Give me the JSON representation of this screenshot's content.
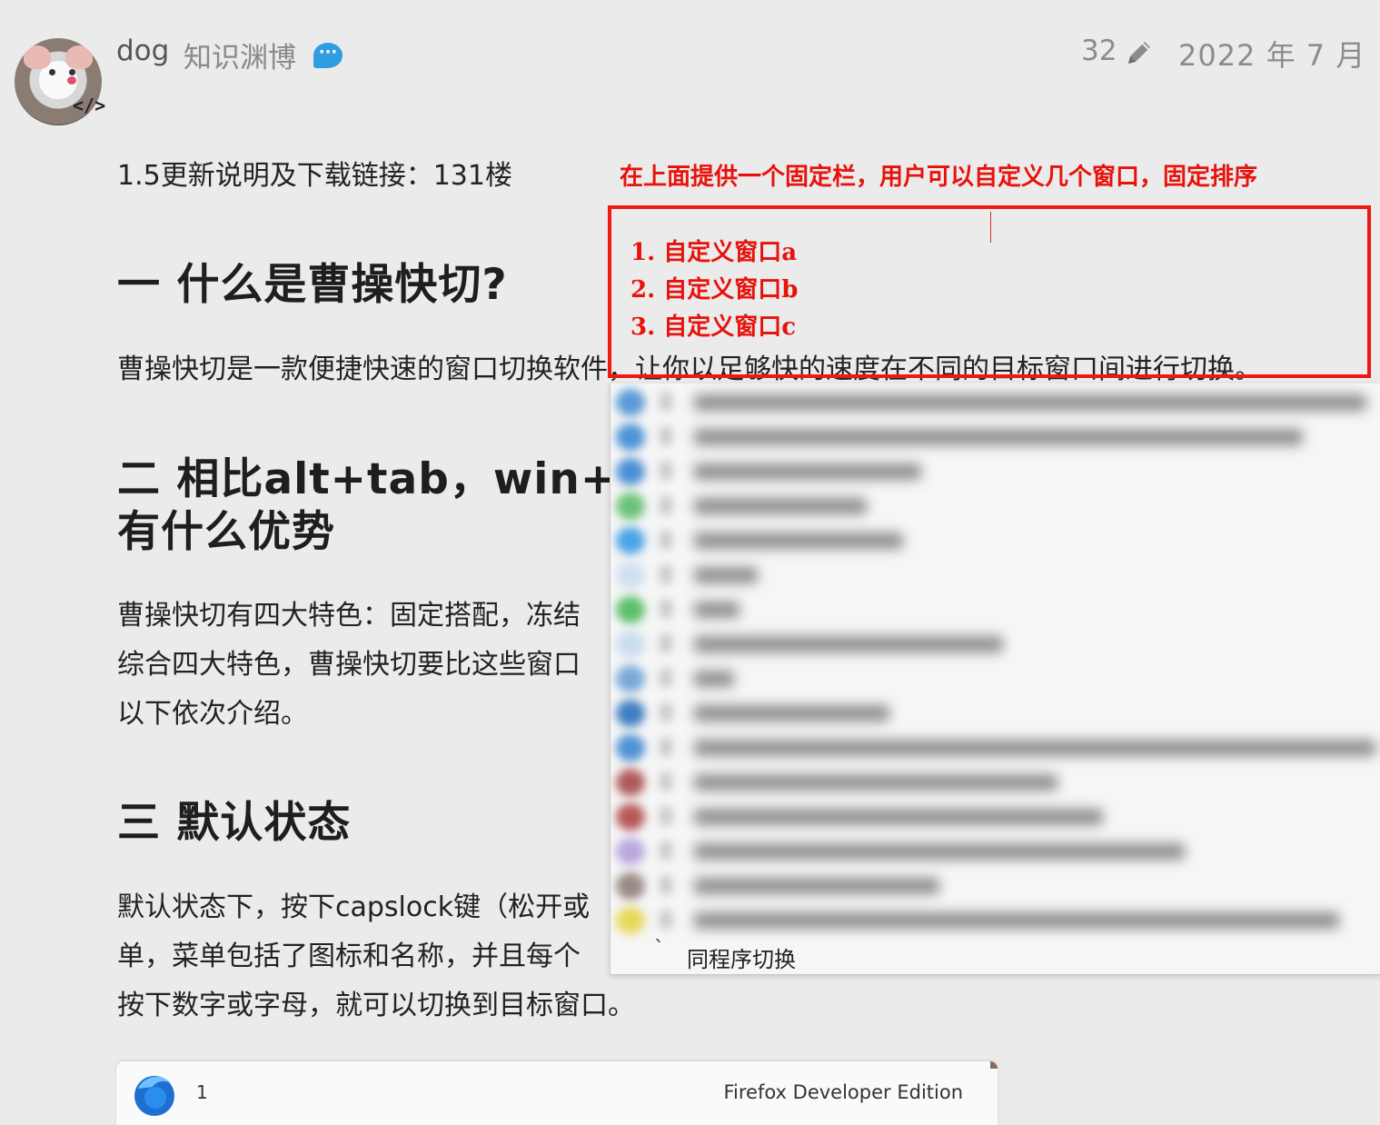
{
  "header": {
    "username": "dog",
    "full_name": "知识渊博",
    "chat_badge": "···",
    "edit_count": "32",
    "date": "2022 年 7 月",
    "avatar_badge": "</>"
  },
  "article": {
    "update_line": "1.5更新说明及下载链接：131楼",
    "heading1": "一 什么是曹操快切?",
    "para1": "曹操快切是一款便捷快速的窗口切换软件，让你以足够快的速度在不同的目标窗口间进行切换。",
    "heading2_line1": "二 相比alt+tab，win+数字",
    "heading2_line2": "有什么优势",
    "para2_line1": "曹操快切有四大特色：固定搭配，冻结",
    "para2_line2": "综合四大特色，曹操快切要比这些窗口",
    "para2_line3": "以下依次介绍。",
    "heading3": "三 默认状态",
    "para3_line1": "默认状态下，按下capslock键（松开或",
    "para3_line2": "单，菜单包括了图标和名称，并且每个",
    "para3_line3": "按下数字或字母，就可以切换到目标窗口。"
  },
  "annotation": {
    "note": "在上面提供一个固定栏，用户可以自定义几个窗口，固定排序",
    "items": [
      "1. 自定义窗口a",
      "2. 自定义窗口b",
      "3. 自定义窗口c"
    ],
    "colors": {
      "annotation": "#e8120c"
    }
  },
  "switcher_menu": {
    "footer_key": "`",
    "footer_label": "同程序切换"
  },
  "bottom_screenshot": {
    "key": "1",
    "label": "Firefox Developer Edition"
  }
}
